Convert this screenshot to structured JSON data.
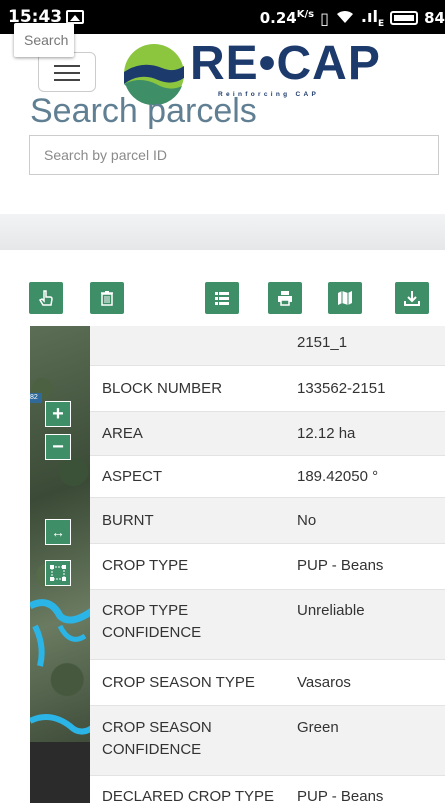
{
  "status_bar": {
    "time": "15:43",
    "speed": "0.24",
    "speed_unit": "K/s",
    "signal_text": ".ıl",
    "network": "E",
    "battery": "84"
  },
  "header": {
    "logo_title": "RE•CAP",
    "logo_subtitle": "Reinforcing CAP",
    "brand_color": "#1d3a6d",
    "accent_color": "#3e8e67"
  },
  "search": {
    "title": "Search parcels",
    "placeholder": "Search by parcel ID"
  },
  "toolbar": {
    "icons": [
      "hand-pointer-icon",
      "trash-icon",
      "list-icon",
      "print-icon",
      "map-icon",
      "download-icon"
    ]
  },
  "map": {
    "search_placeholder": "Search",
    "zoom_in_label": "+",
    "zoom_out_label": "−",
    "scale_label": "82"
  },
  "parcel": {
    "rows": [
      {
        "key": "",
        "value": "2151_1"
      },
      {
        "key": "BLOCK NUMBER",
        "value": "133562-2151"
      },
      {
        "key": "AREA",
        "value": "12.12 ha"
      },
      {
        "key": "ASPECT",
        "value": "189.42050 °"
      },
      {
        "key": "BURNT",
        "value": "No"
      },
      {
        "key": "CROP TYPE",
        "value": "PUP - Beans"
      },
      {
        "key": "CROP TYPE CONFIDENCE",
        "value": "Unreliable"
      },
      {
        "key": "CROP SEASON TYPE",
        "value": "Vasaros"
      },
      {
        "key": "CROP SEASON CONFIDENCE",
        "value": "Green"
      },
      {
        "key": "DECLARED CROP TYPE",
        "value": "PUP - Beans"
      }
    ]
  }
}
